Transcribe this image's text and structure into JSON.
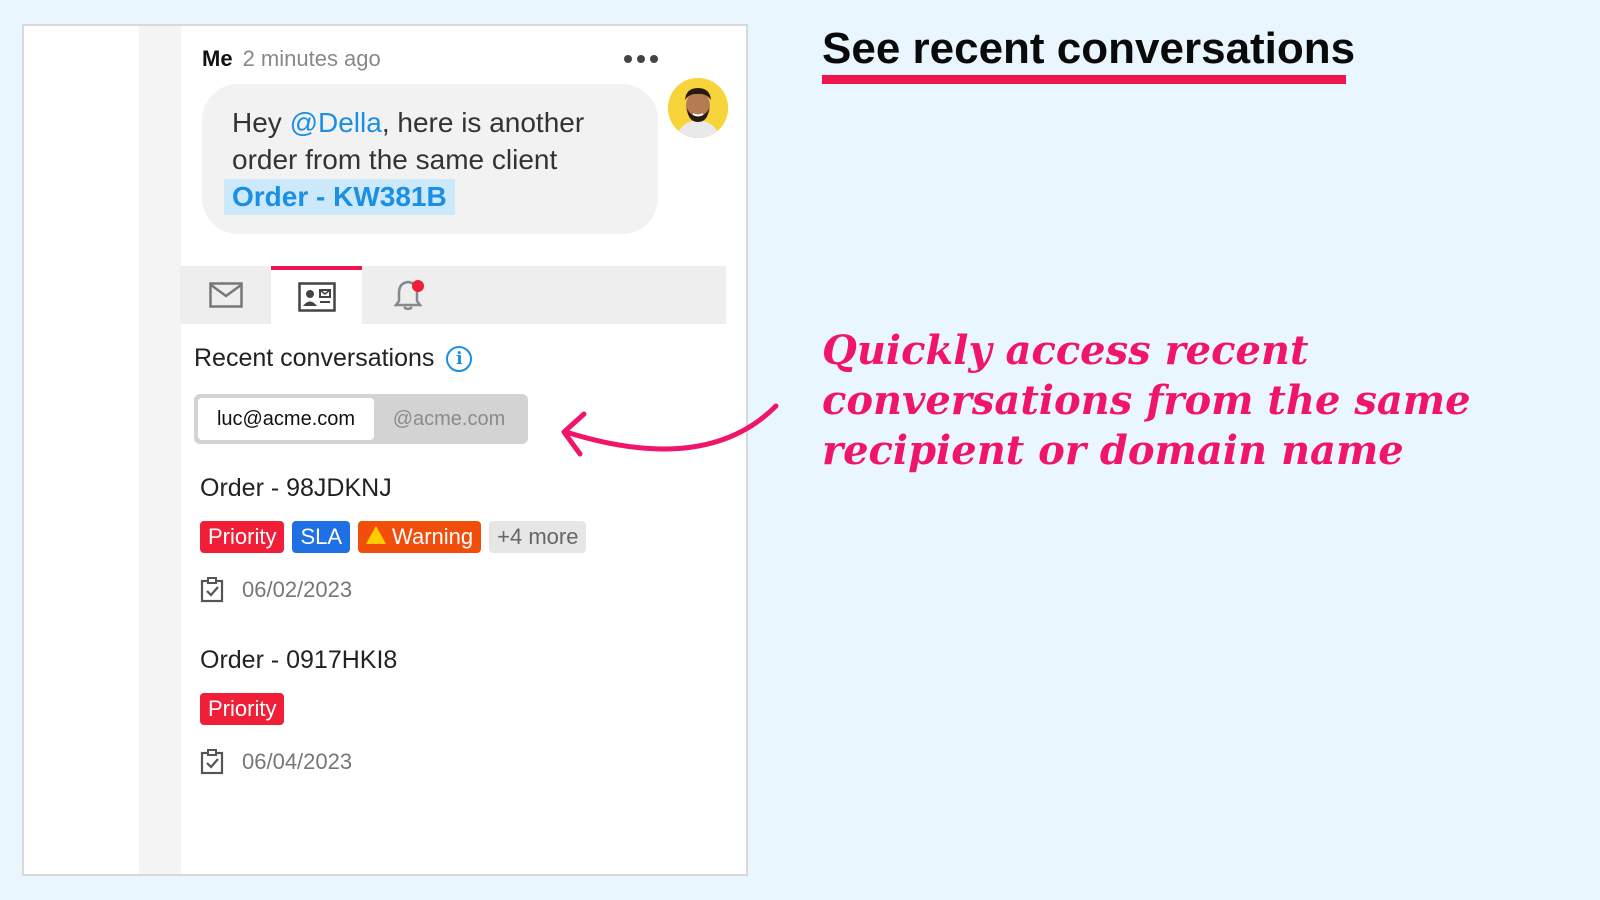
{
  "message": {
    "author": "Me",
    "time": "2 minutes ago",
    "text_before": "Hey ",
    "mention": "@Della",
    "text_after": ", here is another order from the same client",
    "order_link": "Order - KW381B"
  },
  "tabs": [
    {
      "icon": "mail-icon",
      "active": false
    },
    {
      "icon": "contact-card-icon",
      "active": true
    },
    {
      "icon": "bell-icon",
      "active": false,
      "has_notification": true
    }
  ],
  "recent": {
    "title": "Recent conversations",
    "filters": {
      "selected": "luc@acme.com",
      "other": "@acme.com"
    },
    "conversations": [
      {
        "title": "Order - 98JDKNJ",
        "tags": [
          "Priority",
          "SLA",
          "Warning",
          "+4 more"
        ],
        "date": "06/02/2023"
      },
      {
        "title": "Order - 0917HKI8",
        "tags": [
          "Priority"
        ],
        "date": "06/04/2023"
      }
    ]
  },
  "headline": "See recent conversations",
  "callout": "Quickly access recent conversations from the same recipient or domain name",
  "colors": {
    "accent": "#f0144f",
    "link": "#1a8fe3",
    "priority": "#f01e37",
    "sla": "#1f6fe5",
    "warning": "#f24e0b",
    "background": "#eaf6fe"
  }
}
